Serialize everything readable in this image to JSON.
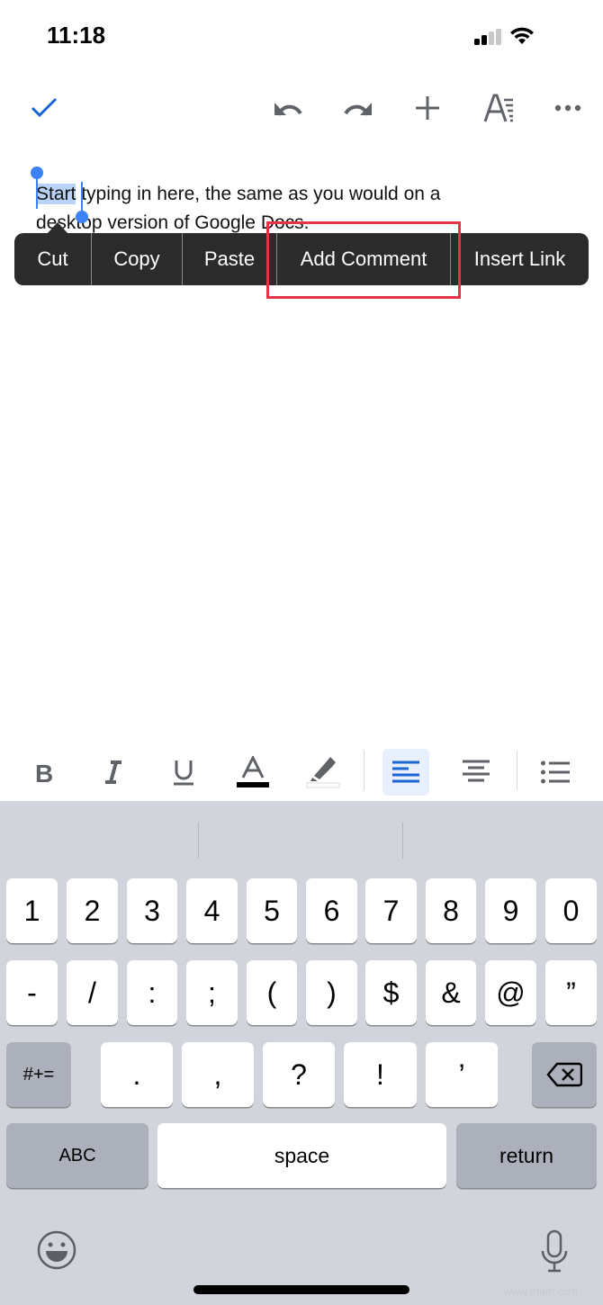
{
  "status_bar": {
    "time": "11:18",
    "signal_bars_active": 2,
    "signal_bars_total": 4
  },
  "toolbar": {
    "done_icon": "checkmark-icon",
    "icons": [
      "undo-icon",
      "redo-icon",
      "insert-plus-icon",
      "text-format-icon",
      "more-options-icon"
    ]
  },
  "document": {
    "selected_text": "Start",
    "line1_rest": " typing in here, the same as you would on a",
    "line2": "desktop version of Google Docs."
  },
  "context_menu": {
    "items": [
      {
        "label": "Cut"
      },
      {
        "label": "Copy"
      },
      {
        "label": "Paste"
      },
      {
        "label": "Add Comment",
        "highlighted": true
      },
      {
        "label": "Insert Link"
      }
    ],
    "highlight_color": "#e53445"
  },
  "format_bar": {
    "buttons": [
      "bold",
      "italic",
      "underline",
      "text-color",
      "highlight-color",
      "align-left",
      "align-center",
      "bulleted-list"
    ],
    "active": "align-left",
    "text_color": "#000000",
    "accent": "#1a66d2"
  },
  "keyboard": {
    "row1": [
      "1",
      "2",
      "3",
      "4",
      "5",
      "6",
      "7",
      "8",
      "9",
      "0"
    ],
    "row2": [
      "-",
      "/",
      ":",
      ";",
      "(",
      ")",
      "$",
      "&",
      "@",
      "”"
    ],
    "row3_left": "#+=",
    "row3": [
      ".",
      ",",
      "?",
      "!",
      "’"
    ],
    "abc_label": "ABC",
    "space_label": "space",
    "return_label": "return"
  },
  "watermark": "www.frfam.com"
}
